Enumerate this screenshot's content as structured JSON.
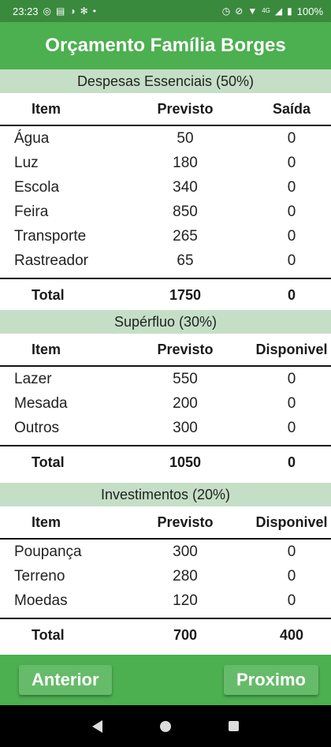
{
  "status": {
    "time": "23:23",
    "left_icons": [
      "whatsapp-icon",
      "news-icon",
      "pie-icon",
      "swirl-icon",
      "dot-icon"
    ],
    "right_icons": [
      "alarm-icon",
      "mute-icon",
      "wifi-icon",
      "signal-icon",
      "battery-icon"
    ],
    "network": "4G",
    "battery": "100%"
  },
  "app": {
    "title": "Orçamento Família Borges"
  },
  "sections": [
    {
      "title": "Despesas Essenciais (50%)",
      "headers": [
        "Item",
        "Previsto",
        "Saída"
      ],
      "rows": [
        [
          "Água",
          "50",
          "0"
        ],
        [
          "Luz",
          "180",
          "0"
        ],
        [
          "Escola",
          "340",
          "0"
        ],
        [
          "Feira",
          "850",
          "0"
        ],
        [
          "Transporte",
          "265",
          "0"
        ],
        [
          "Rastreador",
          "65",
          "0"
        ]
      ],
      "total": [
        "Total",
        "1750",
        "0"
      ]
    },
    {
      "title": "Supérfluo (30%)",
      "headers": [
        "Item",
        "Previsto",
        "Disponivel"
      ],
      "rows": [
        [
          "Lazer",
          "550",
          "0"
        ],
        [
          "Mesada",
          "200",
          "0"
        ],
        [
          "Outros",
          "300",
          "0"
        ]
      ],
      "total": [
        "Total",
        "1050",
        "0"
      ]
    },
    {
      "title": "Investimentos (20%)",
      "headers": [
        "Item",
        "Previsto",
        "Disponivel"
      ],
      "rows": [
        [
          "Poupança",
          "300",
          "0"
        ],
        [
          "Terreno",
          "280",
          "0"
        ],
        [
          "Moedas",
          "120",
          "0"
        ]
      ],
      "total": [
        "Total",
        "700",
        "400"
      ]
    }
  ],
  "buttons": {
    "previous": "Anterior",
    "next": "Proximo"
  },
  "colors": {
    "app_bar": "#4caf50",
    "status_bar": "#3a8a3e",
    "section_header": "#c5dfc6",
    "button": "#66bb6a"
  }
}
